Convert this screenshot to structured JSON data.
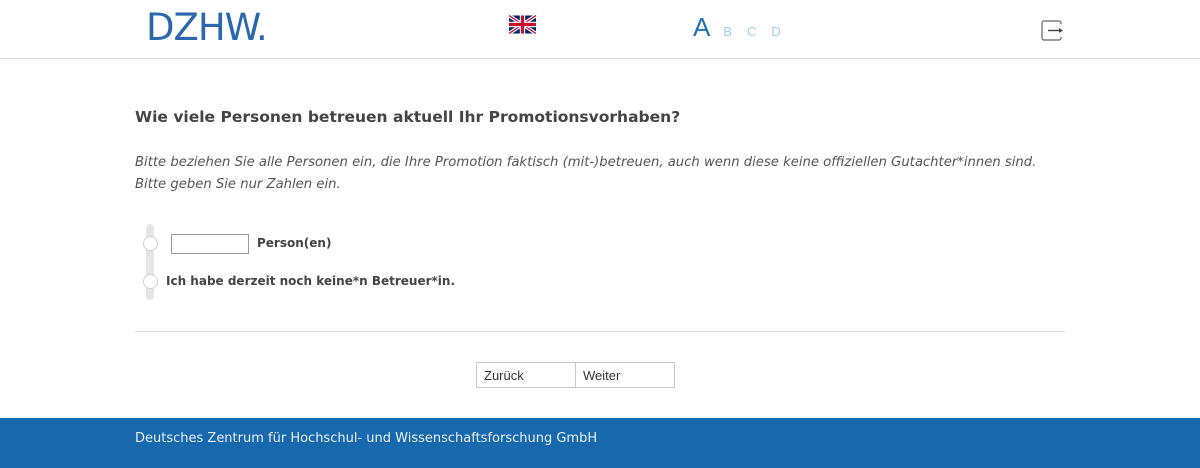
{
  "header": {
    "logo_text": "DZHW.",
    "language_icon": "uk-flag-icon",
    "pages": {
      "current": "A",
      "others": [
        "B",
        "C",
        "D"
      ]
    },
    "logout_icon": "logout-icon"
  },
  "question": {
    "title": "Wie viele Personen betreuen aktuell Ihr Promotionsvorhaben?",
    "hint_line1": "Bitte beziehen Sie alle Personen ein, die Ihre Promotion faktisch (mit-)betreuen, auch wenn diese keine offiziellen Gutachter*innen sind.",
    "hint_line2": "Bitte geben Sie nur Zahlen ein.",
    "option1": {
      "input_value": "",
      "unit_label": "Person(en)"
    },
    "option2": {
      "label": "Ich habe derzeit noch keine*n Betreuer*in."
    }
  },
  "navigation": {
    "back_label": "Zurück",
    "next_label": "Weiter"
  },
  "footer": {
    "text": "Deutsches Zentrum für Hochschul- und Wissenschaftsforschung GmbH"
  },
  "colors": {
    "brand_blue": "#1768ad",
    "logo_blue": "#2a67ac",
    "page_inactive": "#a9cde8"
  }
}
